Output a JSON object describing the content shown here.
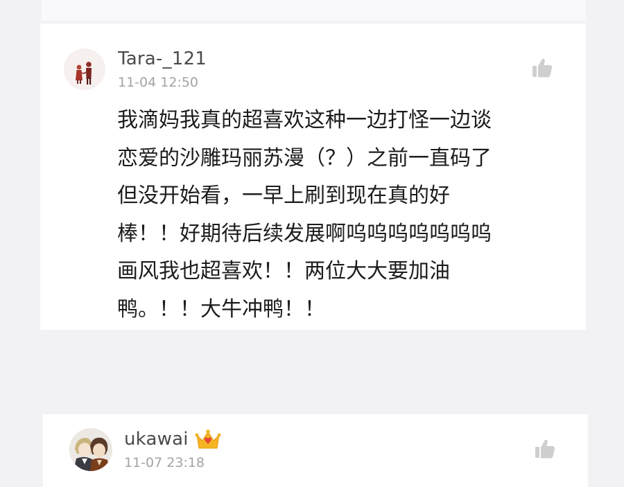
{
  "comments": [
    {
      "username": "Tara-_121",
      "timestamp": "11-04 12:50",
      "text_lines": [
        "我滴妈我真的超喜欢这种一边打怪一边谈",
        "恋爱的沙雕玛丽苏漫（？）之前一直码了",
        "但没开始看，一早上刷到现在真的好",
        "棒！！好期待后续发展啊呜呜呜呜呜呜呜",
        "画风我也超喜欢！！两位大大要加油",
        "鸭。！！大牛冲鸭！！"
      ],
      "avatar_icon": "couple-holding-hands-avatar",
      "like_icon": "thumbs-up-icon"
    },
    {
      "username": "ukawai",
      "timestamp": "11-07 23:18",
      "badge_icon": "crown-badge-icon",
      "avatar_icon": "anime-characters-avatar",
      "like_icon": "thumbs-up-icon"
    }
  ],
  "colors": {
    "background": "#f2f2f4",
    "card": "#ffffff",
    "username": "#4a4a4a",
    "timestamp": "#a3a3a3",
    "text": "#1c1c1c",
    "like_icon": "#cfcfcf",
    "crown": "#f5b423"
  }
}
